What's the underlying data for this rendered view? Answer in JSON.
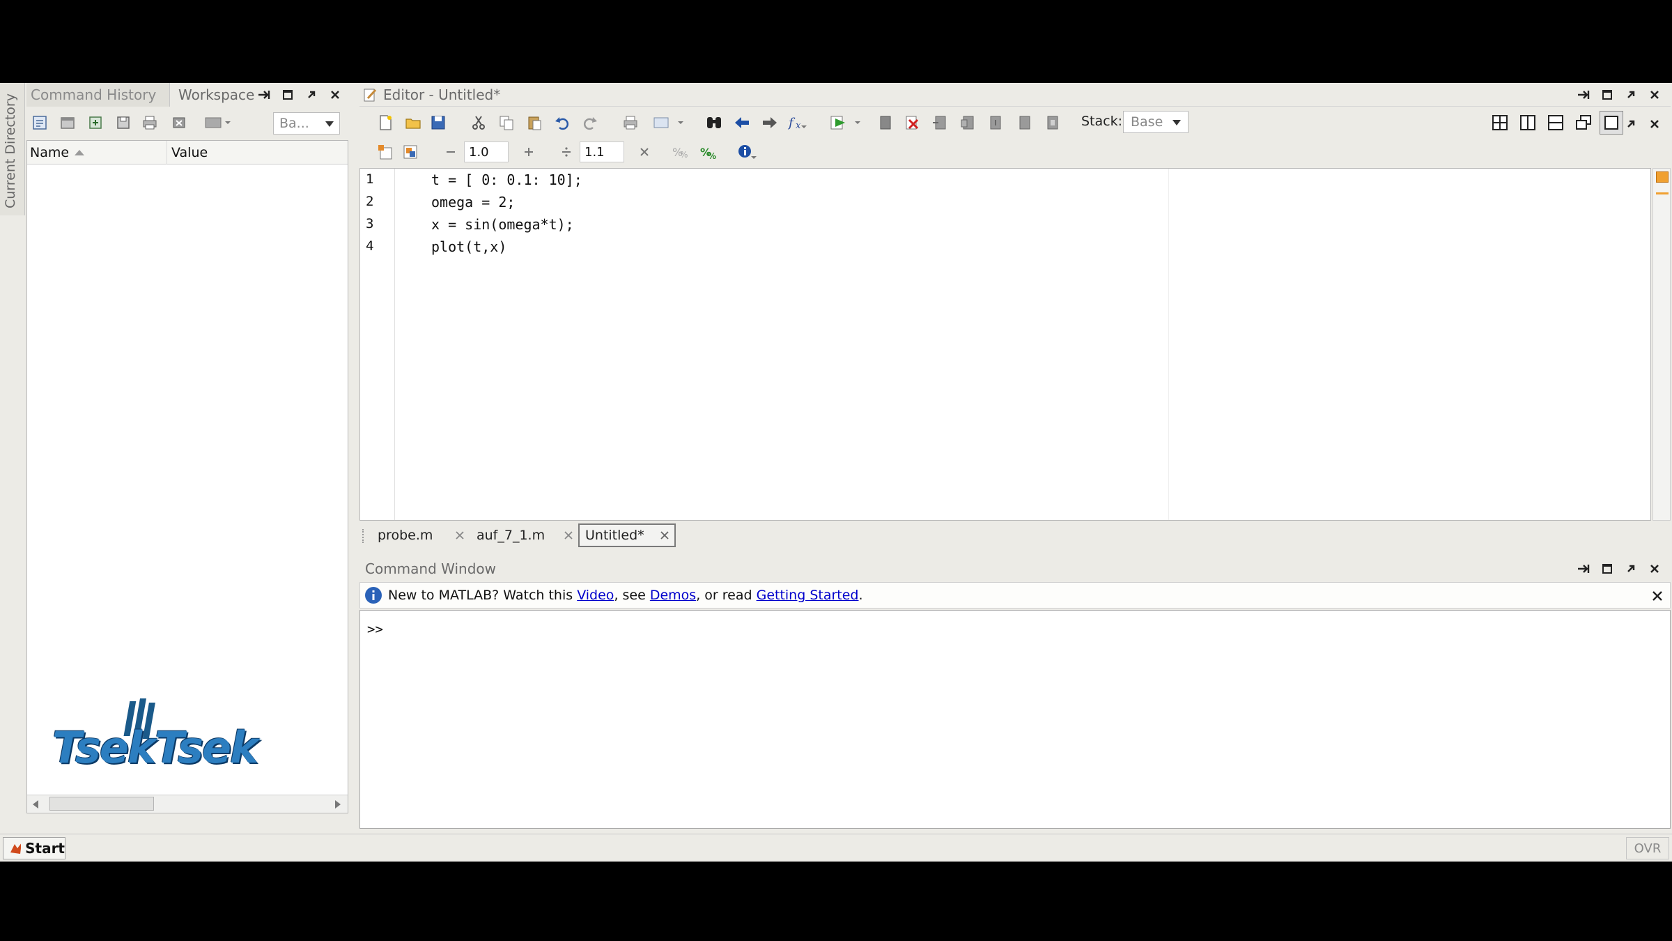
{
  "left_sidebar": {
    "vertical_tab_label": "Current Directory"
  },
  "left_panel": {
    "tabs": [
      {
        "label": "Command History"
      },
      {
        "label": "Workspace"
      }
    ],
    "base_dropdown": "Ba...",
    "columns": {
      "name": "Name",
      "value": "Value"
    },
    "watermark_text": "TsekTsek"
  },
  "editor": {
    "title": "Editor - Untitled*",
    "stack_label": "Stack:",
    "stack_value": "Base",
    "cell_value_1": "1.0",
    "cell_value_2": "1.1",
    "code_lines": [
      {
        "num": "1",
        "text": "t = [ 0: 0.1: 10];"
      },
      {
        "num": "2",
        "text": "omega = 2;"
      },
      {
        "num": "3",
        "text": "x = sin(omega*t);"
      },
      {
        "num": "4",
        "text": "plot(t,x)"
      }
    ],
    "file_tabs": [
      {
        "label": "probe.m"
      },
      {
        "label": "auf_7_1.m"
      },
      {
        "label": "Untitled*"
      }
    ]
  },
  "command_window": {
    "title": "Command Window",
    "info_prefix": "New to MATLAB? Watch this ",
    "link_video": "Video",
    "info_mid1": ", see ",
    "link_demos": "Demos",
    "info_mid2": ", or read ",
    "link_getting_started": "Getting Started",
    "info_suffix": ".",
    "prompt": ">>"
  },
  "status_bar": {
    "start_label": "Start",
    "ovr_label": "OVR"
  },
  "colors": {
    "link": "#0000cc",
    "panel_bg": "#ecebe6",
    "accent_orange": "#f0a030"
  }
}
